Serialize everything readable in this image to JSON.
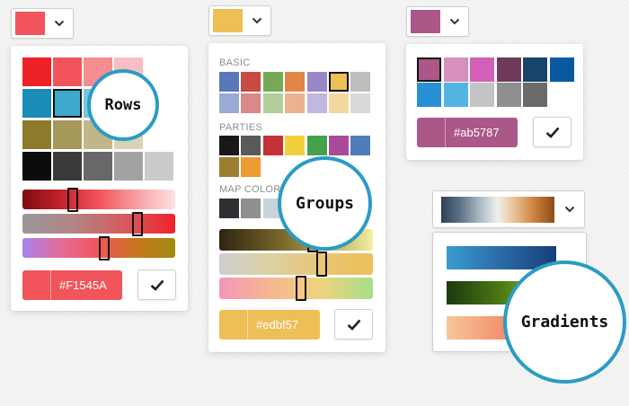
{
  "rows_picker": {
    "trigger_color": "#F1545A",
    "callout": "Rows",
    "hex_value": "#F1545A",
    "swatch_rows": [
      [
        "#ee2127",
        "#f1545a",
        "#f48c90",
        "#f7bfc1"
      ],
      [
        "#1b8cb6",
        "#3fa9cc",
        "#78c3dd",
        "#b3dcec"
      ],
      [
        "#8e7a2c",
        "#a69859",
        "#c0b689",
        "#d8d2b8"
      ],
      [
        "#0c0c0c",
        "#3a3a3a",
        "#686868",
        "#a2a2a2",
        "#cbcbcb"
      ]
    ],
    "selected_swatch": "1,1"
  },
  "groups_picker": {
    "trigger_color": "#edbf57",
    "callout": "Groups",
    "hex_value": "#edbf57",
    "groups": [
      {
        "label": "BASIC",
        "swatches": [
          "#5a78b8",
          "#c74a43",
          "#76a855",
          "#e08646",
          "#9a88c6",
          "#edbf57",
          "#bdbdbd",
          "#9aaad3",
          "#d98a86",
          "#b1ce9b",
          "#ebb28d",
          "#c1b8dd",
          "#f3d99e",
          "#d9d9d9"
        ]
      },
      {
        "label": "PARTIES",
        "swatches": [
          "#181818",
          "#5a5a5a",
          "#c43235",
          "#f2cf3d",
          "#45a04e",
          "#a94a9b",
          "#4f7dba",
          "#9b7e31",
          "#ee9b31"
        ]
      },
      {
        "label": "MAP COLORS",
        "swatches": [
          "#2f3034",
          "#8f8f8f",
          "#c8d3da"
        ]
      }
    ],
    "selected_swatch": "#edbf57"
  },
  "right_picker": {
    "trigger_color": "#ab5787",
    "hex_value": "#ab5787",
    "swatches": [
      "#ab5787",
      "#d68fbf",
      "#d35fb9",
      "#713a5c",
      "#18446b",
      "#075aa0",
      "#2790d4",
      "#53b4e3",
      "#c4c4c4",
      "#8f8f8f",
      "#6a6a6a"
    ],
    "selected_swatch": "#ab5787"
  },
  "gradients_picker": {
    "callout": "Gradients"
  },
  "icons": {
    "chevron": "chevron-down-icon",
    "check": "checkmark-icon"
  }
}
